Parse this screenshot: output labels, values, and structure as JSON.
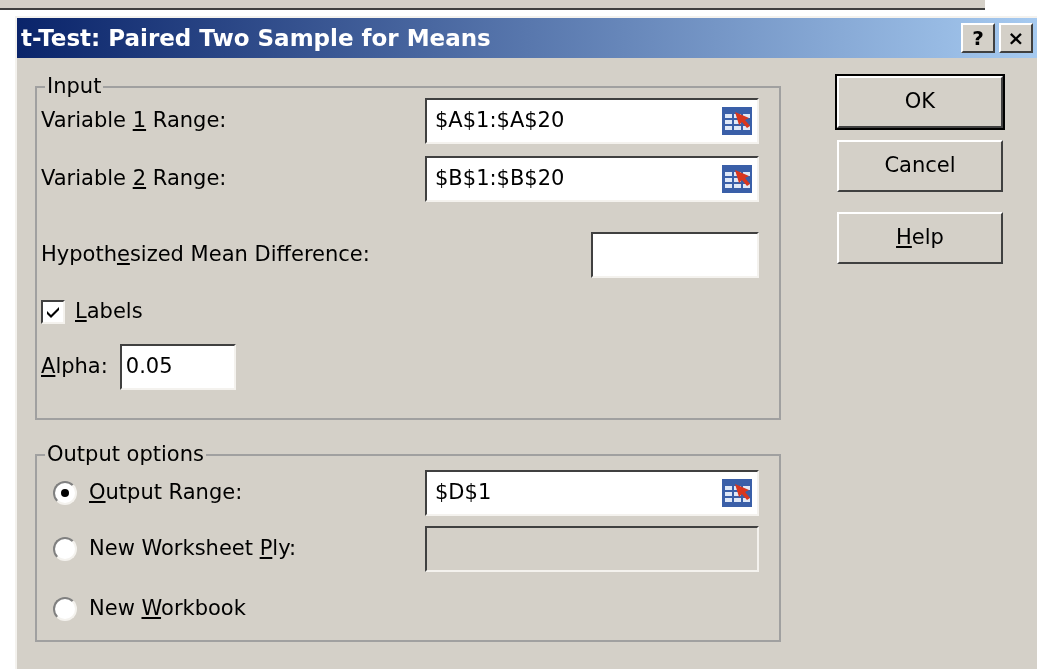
{
  "window": {
    "title": "t-Test: Paired Two Sample for Means",
    "title_buttons": [
      "?",
      "×"
    ]
  },
  "input": {
    "title": "Input",
    "variable_1_range": {
      "label": {
        "before": "Variable ",
        "key": "1",
        "after": " Range:"
      },
      "value": "$A$1:$A$20"
    },
    "variable_2_range": {
      "label": {
        "before": "Variable ",
        "key": "2",
        "after": " Range:"
      },
      "value": "$B$1:$B$20"
    },
    "hypothesized_mean_difference": {
      "label": {
        "before": "Hypoth",
        "key": "e",
        "after": "sized Mean Difference:"
      }
    },
    "labels": {
      "label": {
        "key": "L",
        "after": "abels"
      },
      "checked": true
    },
    "alpha": {
      "label": {
        "key": "A",
        "after": "lpha:"
      },
      "value": "0.05"
    }
  },
  "output_options": {
    "title": "Output options",
    "options": [
      {
        "label": {
          "key": "O",
          "after": "utput Range:"
        },
        "selected": true,
        "field": {
          "value": "$D$1",
          "disabled": false
        }
      },
      {
        "label": {
          "before": "New Worksheet ",
          "key": "P",
          "after": "ly:"
        },
        "selected": false,
        "field": {
          "disabled": true
        }
      },
      {
        "label": {
          "before": "New ",
          "key": "W",
          "after": "orkbook"
        },
        "selected": false
      }
    ]
  },
  "buttons": [
    {
      "label": {
        "after": "OK"
      },
      "default": true
    },
    {
      "label": {
        "after": "Cancel"
      },
      "default": false
    },
    {
      "label": {
        "key": "H",
        "after": "elp"
      },
      "default": false
    }
  ]
}
